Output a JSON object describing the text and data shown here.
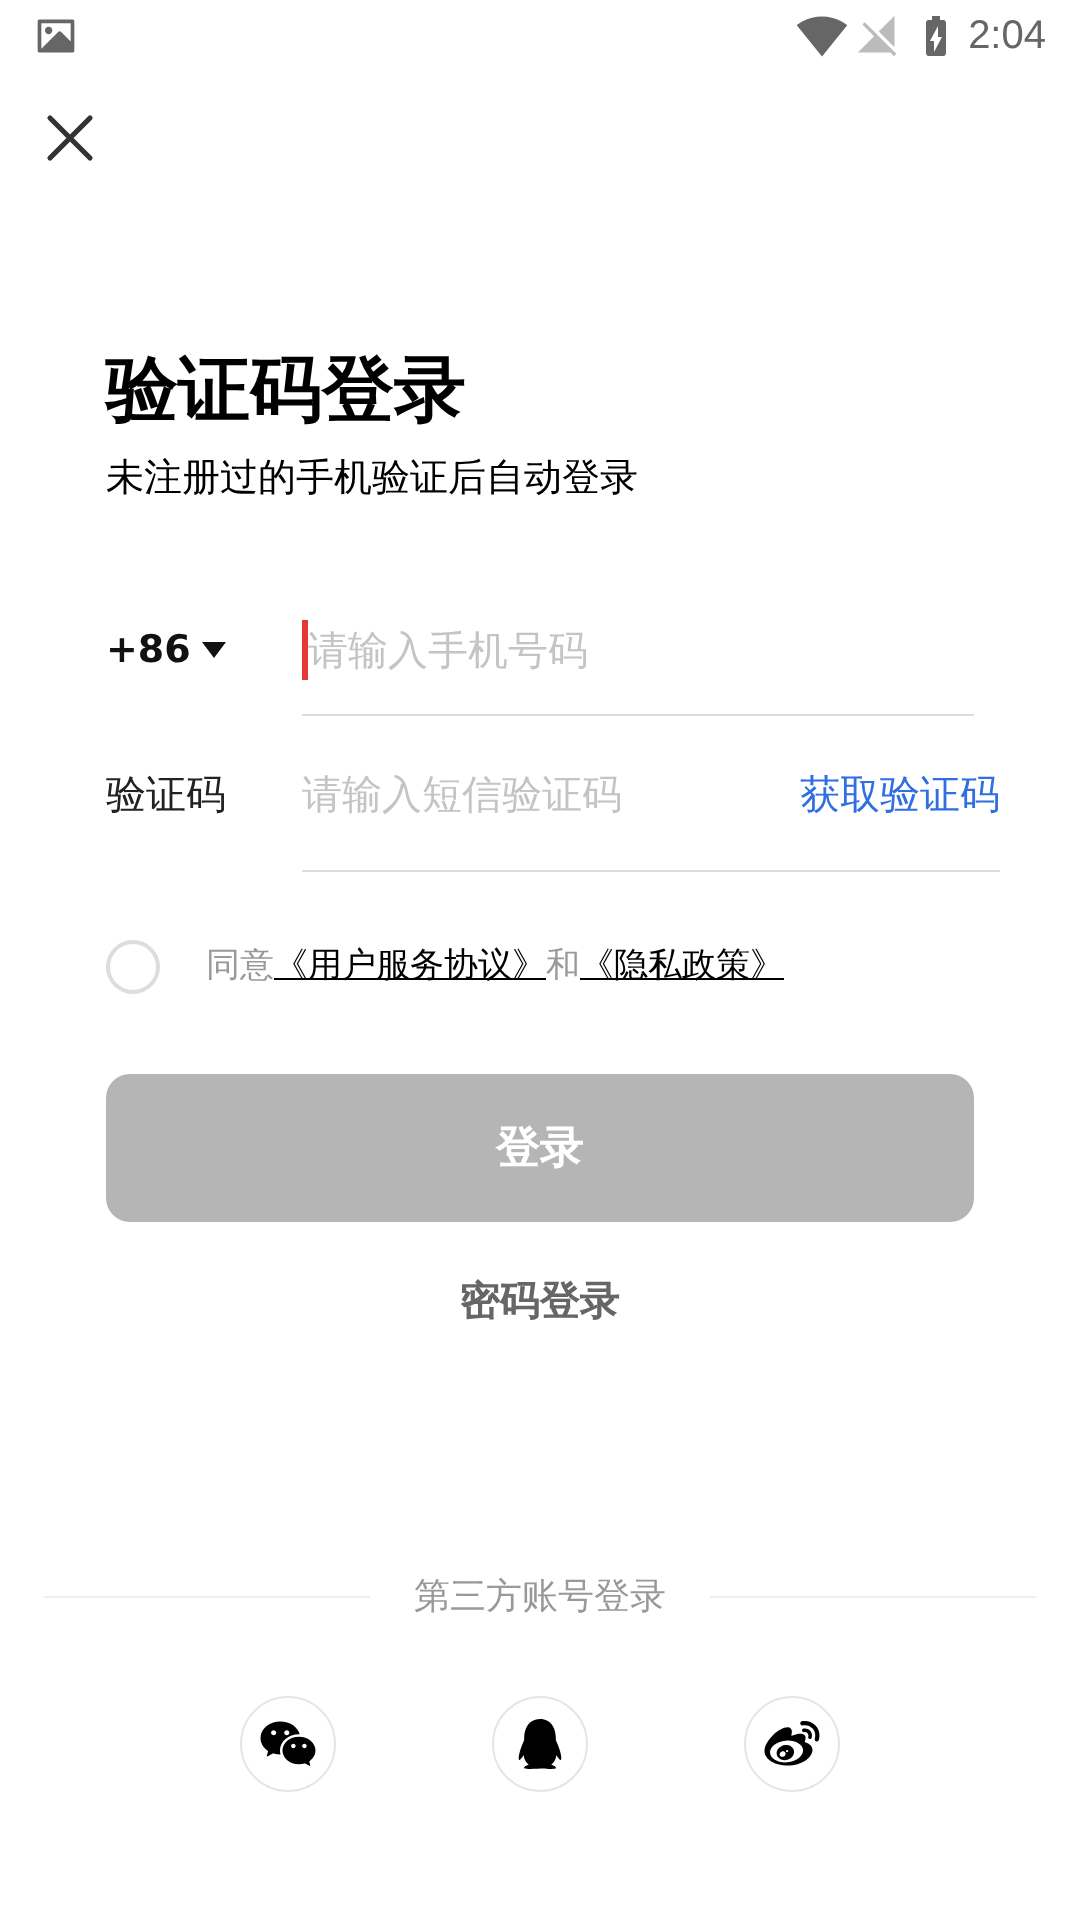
{
  "status_bar": {
    "time": "2:04"
  },
  "title": "验证码登录",
  "subtitle": "未注册过的手机验证后自动登录",
  "phone": {
    "country_code": "+86",
    "placeholder": "请输入手机号码"
  },
  "code": {
    "label": "验证码",
    "placeholder": "请输入短信验证码",
    "get_code": "获取验证码"
  },
  "agreement": {
    "checked": false,
    "prefix": "同意",
    "link_1": "《用户服务协议》",
    "middle": "和",
    "link_2": "《隐私政策》"
  },
  "login_button": {
    "label": "登录",
    "disabled": true
  },
  "password_login": "密码登录",
  "third_party": {
    "label": "第三方账号登录",
    "providers": [
      {
        "kind": "wechat"
      },
      {
        "kind": "qq"
      },
      {
        "kind": "weibo"
      }
    ]
  }
}
